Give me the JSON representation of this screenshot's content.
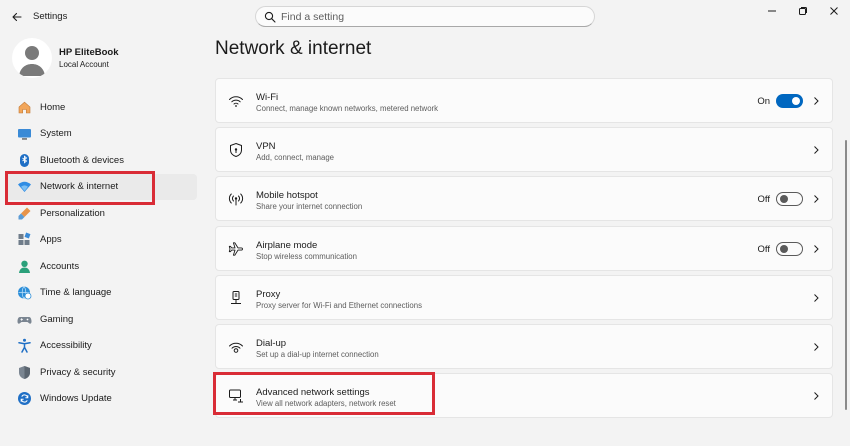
{
  "window": {
    "title": "Settings"
  },
  "search": {
    "placeholder": "Find a setting"
  },
  "account": {
    "name": "HP EliteBook",
    "type": "Local Account"
  },
  "nav": {
    "items": [
      {
        "label": "Home",
        "icon": "home-icon"
      },
      {
        "label": "System",
        "icon": "system-icon"
      },
      {
        "label": "Bluetooth & devices",
        "icon": "bluetooth-icon"
      },
      {
        "label": "Network & internet",
        "icon": "network-icon",
        "active": true
      },
      {
        "label": "Personalization",
        "icon": "brush-icon"
      },
      {
        "label": "Apps",
        "icon": "apps-icon"
      },
      {
        "label": "Accounts",
        "icon": "accounts-icon"
      },
      {
        "label": "Time & language",
        "icon": "globe-clock-icon"
      },
      {
        "label": "Gaming",
        "icon": "gamepad-icon"
      },
      {
        "label": "Accessibility",
        "icon": "accessibility-icon"
      },
      {
        "label": "Privacy & security",
        "icon": "shield-icon"
      },
      {
        "label": "Windows Update",
        "icon": "update-icon"
      }
    ]
  },
  "main": {
    "title": "Network & internet",
    "cards": [
      {
        "title": "Wi-Fi",
        "sub": "Connect, manage known networks, metered network",
        "icon": "wifi-icon",
        "state": "On",
        "toggle": true
      },
      {
        "title": "VPN",
        "sub": "Add, connect, manage",
        "icon": "vpn-shield-icon"
      },
      {
        "title": "Mobile hotspot",
        "sub": "Share your internet connection",
        "icon": "hotspot-icon",
        "state": "Off",
        "toggle": false
      },
      {
        "title": "Airplane mode",
        "sub": "Stop wireless communication",
        "icon": "airplane-icon",
        "state": "Off",
        "toggle": false
      },
      {
        "title": "Proxy",
        "sub": "Proxy server for Wi-Fi and Ethernet connections",
        "icon": "proxy-icon"
      },
      {
        "title": "Dial-up",
        "sub": "Set up a dial-up internet connection",
        "icon": "dialup-icon"
      },
      {
        "title": "Advanced network settings",
        "sub": "View all network adapters, network reset",
        "icon": "monitor-network-icon"
      }
    ]
  },
  "colors": {
    "accent": "#0067c0",
    "highlight": "#d92c36"
  }
}
